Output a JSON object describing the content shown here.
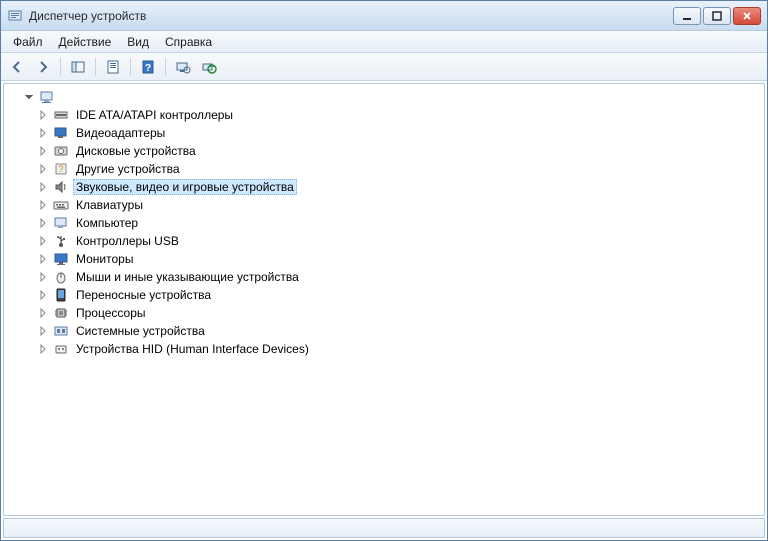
{
  "window": {
    "title": "Диспетчер устройств"
  },
  "menus": {
    "file": "Файл",
    "action": "Действие",
    "view": "Вид",
    "help": "Справка"
  },
  "tree": {
    "root": {
      "label": ""
    },
    "items": [
      {
        "label": "IDE ATA/ATAPI контроллеры",
        "icon": "ide"
      },
      {
        "label": "Видеоадаптеры",
        "icon": "display"
      },
      {
        "label": "Дисковые устройства",
        "icon": "disk"
      },
      {
        "label": "Другие устройства",
        "icon": "other"
      },
      {
        "label": "Звуковые, видео и игровые устройства",
        "icon": "sound",
        "selected": true
      },
      {
        "label": "Клавиатуры",
        "icon": "keyboard"
      },
      {
        "label": "Компьютер",
        "icon": "computer"
      },
      {
        "label": "Контроллеры USB",
        "icon": "usb"
      },
      {
        "label": "Мониторы",
        "icon": "monitor"
      },
      {
        "label": "Мыши и иные указывающие устройства",
        "icon": "mouse"
      },
      {
        "label": "Переносные устройства",
        "icon": "portable"
      },
      {
        "label": "Процессоры",
        "icon": "cpu"
      },
      {
        "label": "Системные устройства",
        "icon": "system"
      },
      {
        "label": "Устройства HID (Human Interface Devices)",
        "icon": "hid"
      }
    ]
  }
}
